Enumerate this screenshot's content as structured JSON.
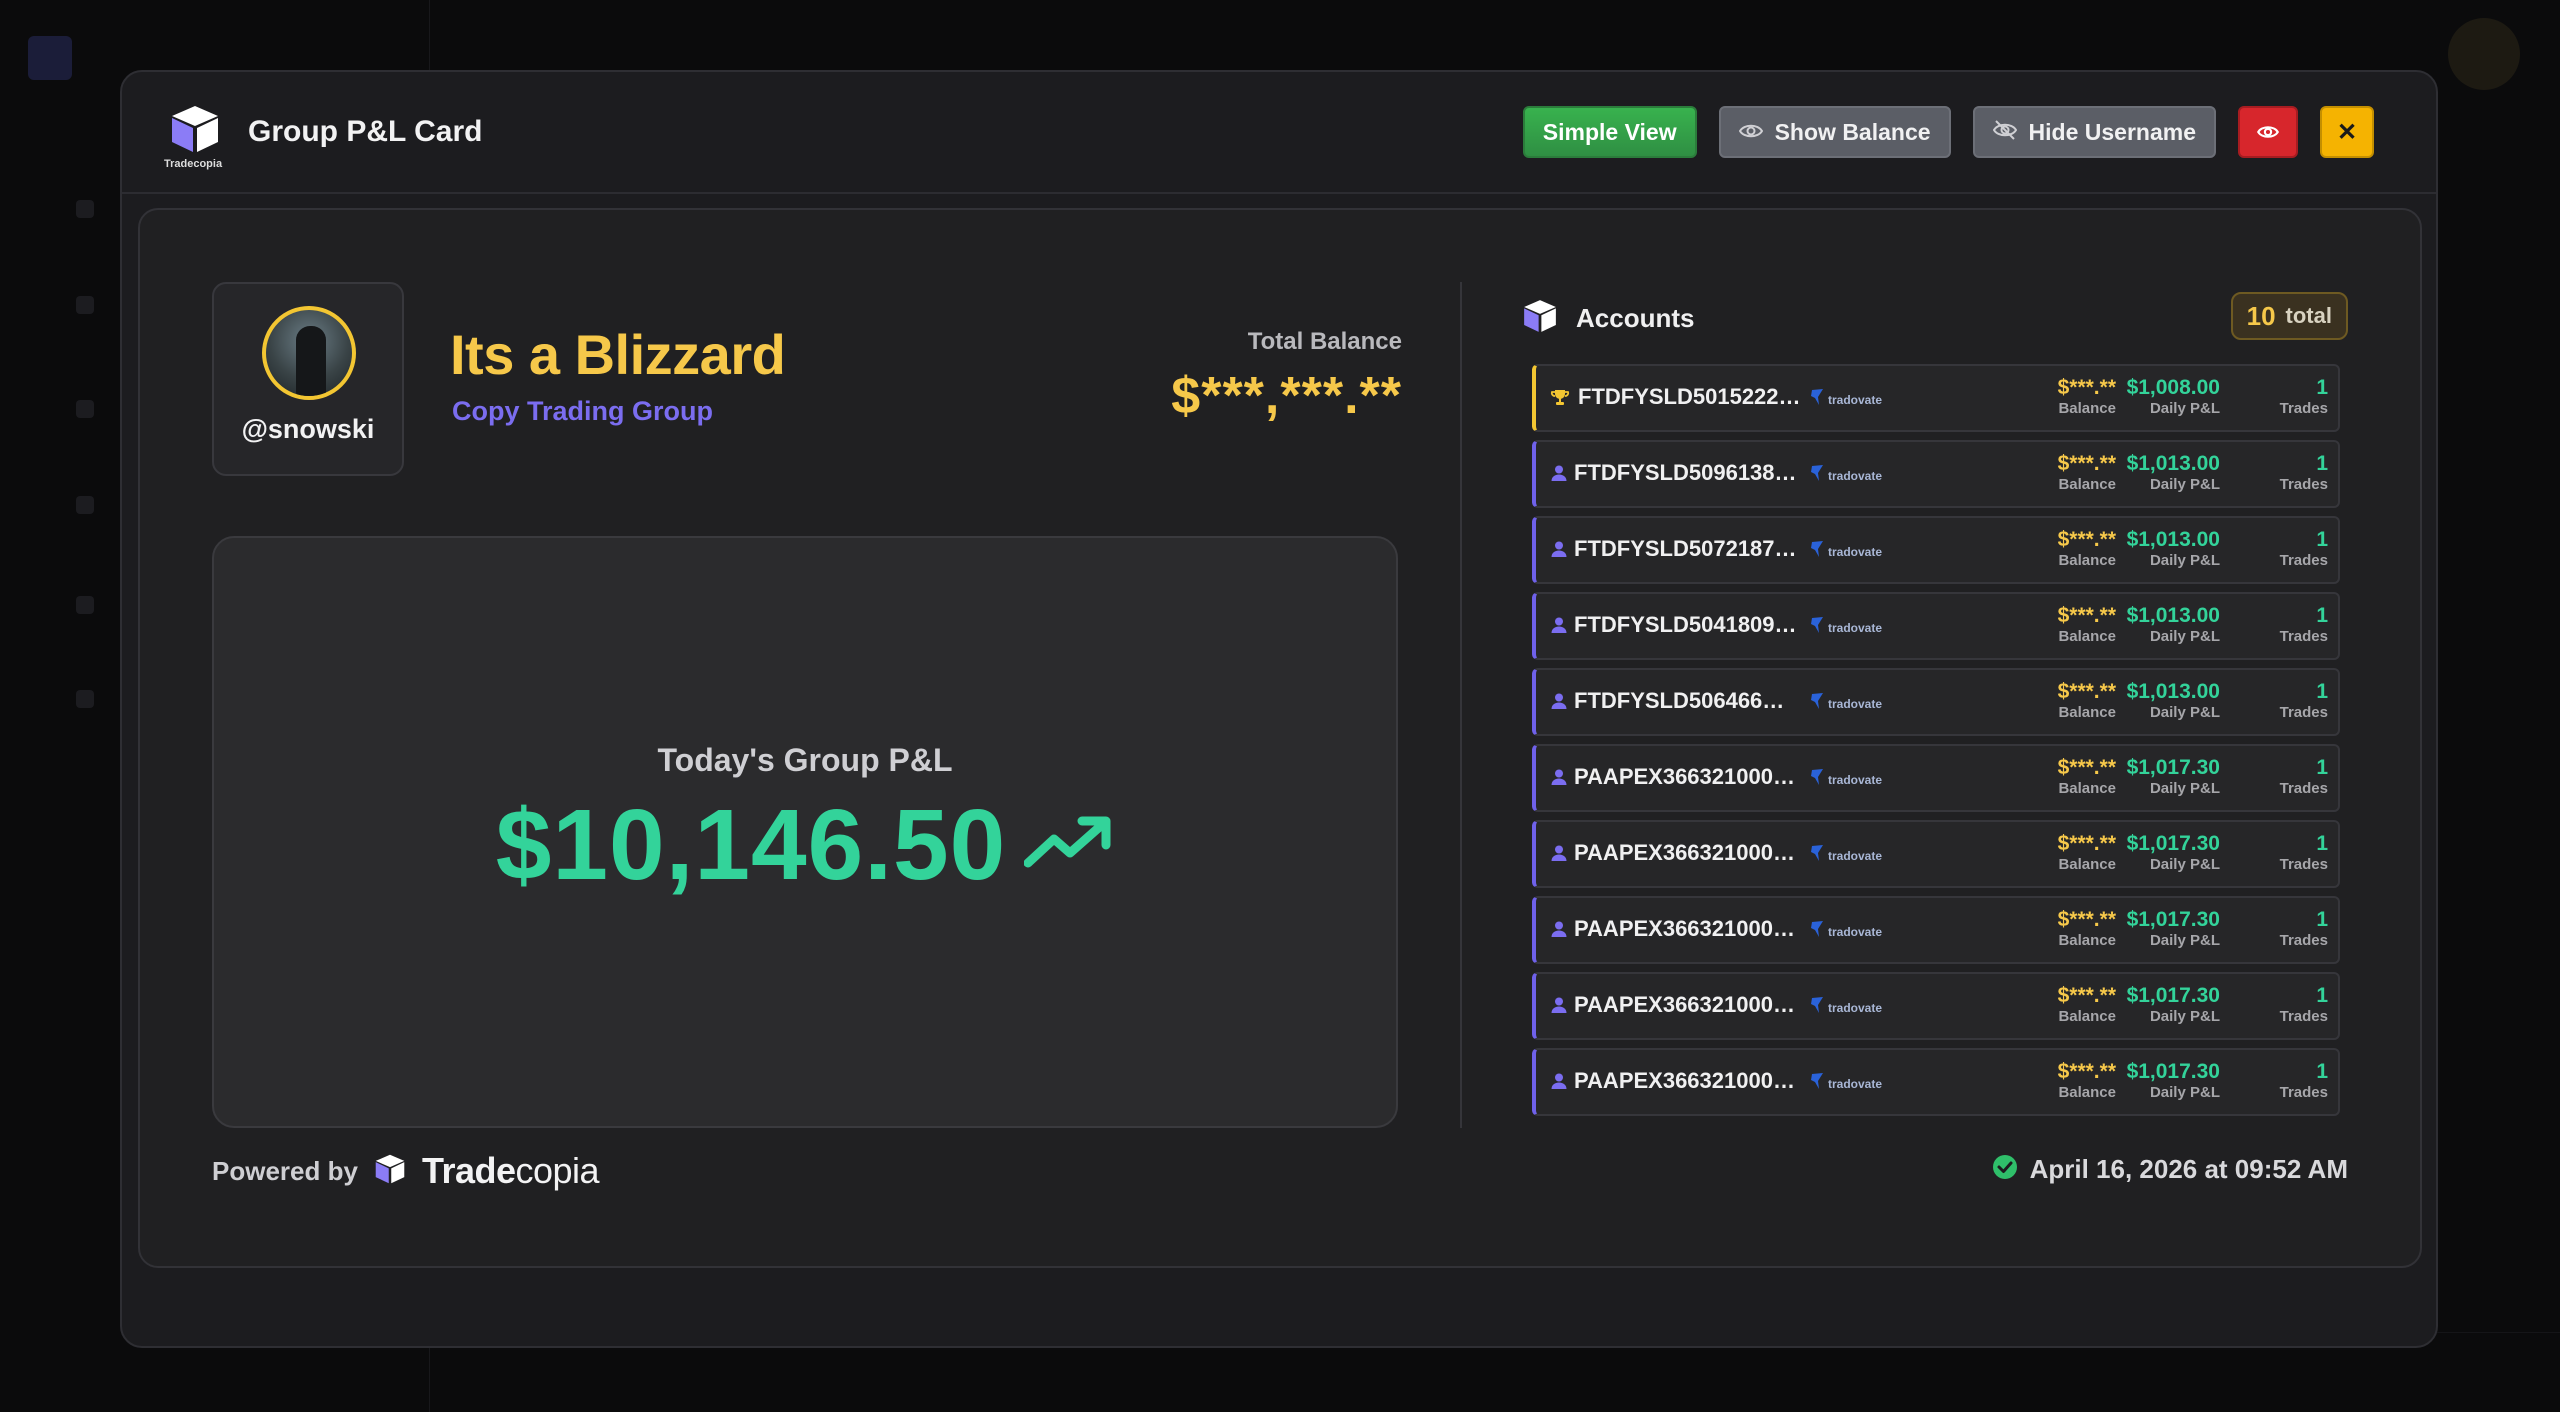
{
  "modal": {
    "title": "Group P&L Card",
    "logo_small_text": "Tradecopia",
    "buttons": {
      "simple_view": "Simple View",
      "show_balance": "Show Balance",
      "hide_username": "Hide Username",
      "close": "✕"
    }
  },
  "card": {
    "username": "@snowski",
    "group_name": "Its a Blizzard",
    "group_subtitle": "Copy Trading Group",
    "total_balance_label": "Total Balance",
    "total_balance_value": "$***,***.**",
    "pnl_label": "Today's Group P&L",
    "pnl_value": "$10,146.50",
    "accounts_title": "Accounts",
    "accounts_total_count": "10",
    "accounts_total_label": "total",
    "powered_by": "Powered by",
    "brand_bold": "Trade",
    "brand_light": "copia",
    "timestamp": "April 16, 2026 at 09:52 AM"
  },
  "labels": {
    "balance": "Balance",
    "daily_pnl": "Daily P&L",
    "trades": "Trades"
  },
  "accounts": [
    {
      "name": "FTDFYSLD5015222…",
      "broker": "tradovate",
      "balance": "$***.**",
      "daily_pnl": "$1,008.00",
      "trades": "1",
      "top": true
    },
    {
      "name": "FTDFYSLD5096138…",
      "broker": "tradovate",
      "balance": "$***.**",
      "daily_pnl": "$1,013.00",
      "trades": "1",
      "top": false
    },
    {
      "name": "FTDFYSLD5072187…",
      "broker": "tradovate",
      "balance": "$***.**",
      "daily_pnl": "$1,013.00",
      "trades": "1",
      "top": false
    },
    {
      "name": "FTDFYSLD5041809…",
      "broker": "tradovate",
      "balance": "$***.**",
      "daily_pnl": "$1,013.00",
      "trades": "1",
      "top": false
    },
    {
      "name": "FTDFYSLD506466…",
      "broker": "tradovate",
      "balance": "$***.**",
      "daily_pnl": "$1,013.00",
      "trades": "1",
      "top": false
    },
    {
      "name": "PAAPEX366321000…",
      "broker": "tradovate",
      "balance": "$***.**",
      "daily_pnl": "$1,017.30",
      "trades": "1",
      "top": false
    },
    {
      "name": "PAAPEX366321000…",
      "broker": "tradovate",
      "balance": "$***.**",
      "daily_pnl": "$1,017.30",
      "trades": "1",
      "top": false
    },
    {
      "name": "PAAPEX366321000…",
      "broker": "tradovate",
      "balance": "$***.**",
      "daily_pnl": "$1,017.30",
      "trades": "1",
      "top": false
    },
    {
      "name": "PAAPEX366321000…",
      "broker": "tradovate",
      "balance": "$***.**",
      "daily_pnl": "$1,017.30",
      "trades": "1",
      "top": false
    },
    {
      "name": "PAAPEX366321000…",
      "broker": "tradovate",
      "balance": "$***.**",
      "daily_pnl": "$1,017.30",
      "trades": "1",
      "top": false
    }
  ],
  "colors": {
    "accent_yellow": "#f6c84a",
    "accent_green": "#33d39a",
    "accent_purple": "#7b6df0"
  },
  "icons": {
    "eye": "eye-icon",
    "eye_off": "eye-off-icon",
    "close": "close-icon",
    "trophy": "trophy-icon",
    "user": "user-icon",
    "trend_up": "trend-up-icon",
    "check": "check-circle-icon"
  }
}
